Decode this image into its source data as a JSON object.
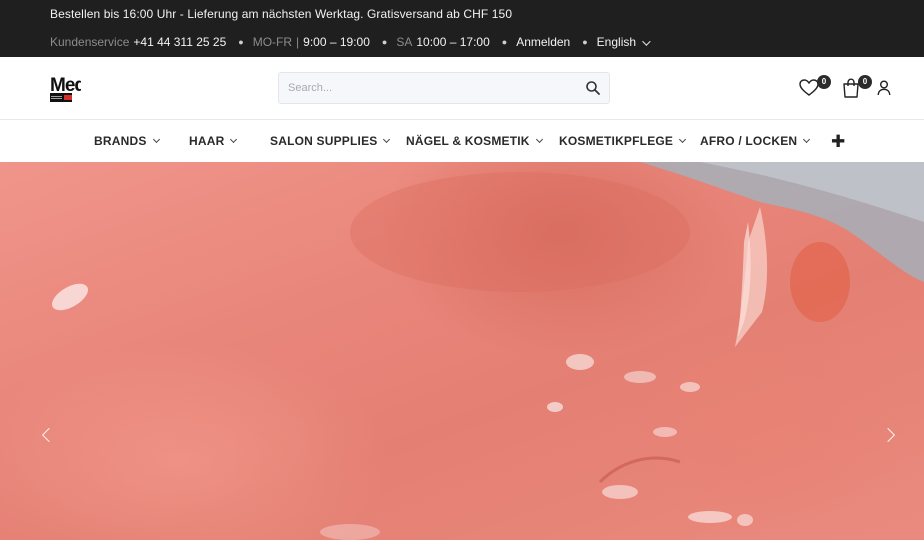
{
  "topbar": {
    "promo": "Bestellen bis 16:00 Uhr  -  Lieferung am nächsten Werktag. Gratisversand ab CHF 150",
    "service_label": "Kundenservice",
    "phone": "+41 44 311 25 25",
    "weekday_label": "MO-FR",
    "weekday_hours": "9:00 – 19:00",
    "saturday_label": "SA",
    "saturday_hours": "10:00 – 17:00",
    "login": "Anmelden",
    "language": "English"
  },
  "header": {
    "logo_text": "Med",
    "search": {
      "placeholder": "Search..."
    },
    "wishlist_count": "0",
    "cart_count": "0"
  },
  "nav": {
    "items": [
      {
        "label": "BRANDS"
      },
      {
        "label": "HAAR"
      },
      {
        "label": "SALON SUPPLIES"
      },
      {
        "label": "NÄGEL & KOSMETIK"
      },
      {
        "label": "KOSMETIKPFLEGE"
      },
      {
        "label": "AFRO / LOCKEN"
      }
    ],
    "more": "✚"
  },
  "colors": {
    "topbar_bg": "#1f1f1f",
    "hero_coral": "#e9867b",
    "accent_red": "#d0322c"
  }
}
